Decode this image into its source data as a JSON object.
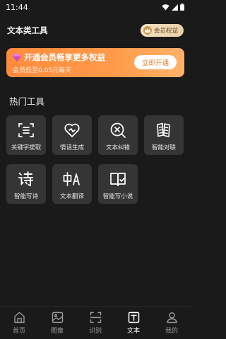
{
  "status": {
    "time": "11:44"
  },
  "header": {
    "title": "文本类工具",
    "vip_badge": "会员权益"
  },
  "banner": {
    "title": "开通会员畅享更多权益",
    "subtitle": "会员低至0.05元每天",
    "button": "立即开通"
  },
  "section": {
    "title": "热门工具"
  },
  "tools": [
    {
      "label": "关键字提取",
      "icon": "keyword-extract-icon"
    },
    {
      "label": "情话生成",
      "icon": "heart-icon"
    },
    {
      "label": "文本纠错",
      "icon": "magnify-x-icon"
    },
    {
      "label": "智能对联",
      "icon": "couplet-icon"
    },
    {
      "label": "智能写诗",
      "icon": "poem-icon"
    },
    {
      "label": "文本翻译",
      "icon": "translate-icon"
    },
    {
      "label": "智能写小说",
      "icon": "book-icon"
    }
  ],
  "nav": [
    {
      "label": "首页",
      "icon": "home-icon"
    },
    {
      "label": "图像",
      "icon": "image-icon"
    },
    {
      "label": "识别",
      "icon": "scan-icon"
    },
    {
      "label": "文本",
      "icon": "text-icon",
      "active": true
    },
    {
      "label": "我的",
      "icon": "profile-icon"
    }
  ],
  "colors": {
    "accent": "#ff8b3d",
    "background": "#1a1a1a",
    "tile": "#353535"
  }
}
